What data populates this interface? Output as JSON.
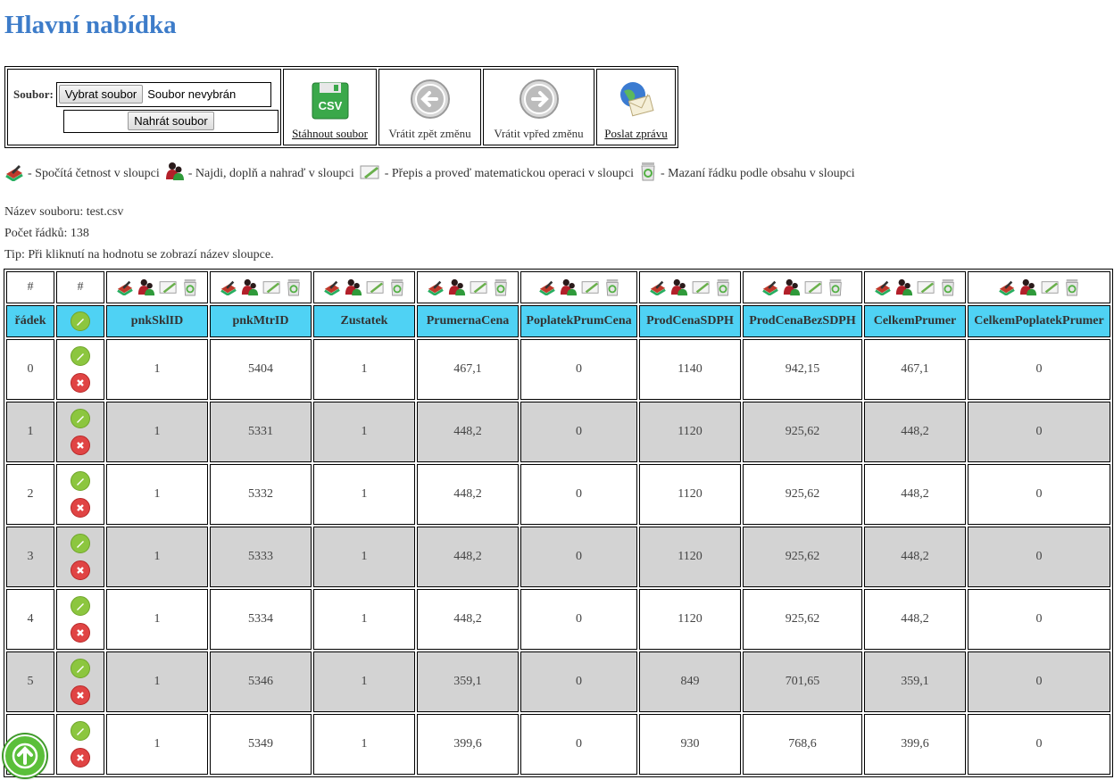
{
  "title": "Hlavní nabídka",
  "toolbar": {
    "file_label": "Soubor:",
    "choose_button": "Vybrat soubor",
    "file_status": "Soubor nevybrán",
    "upload_button": "Nahrát soubor",
    "csv_badge": "CSV",
    "download_label": "Stáhnout soubor",
    "undo_label": "Vrátit zpět změnu",
    "redo_label": "Vrátit vpřed změnu",
    "send_label": "Poslat zprávu"
  },
  "legend": {
    "count": "- Spočítá četnost v sloupci",
    "find": "- Najdi, doplň a nahraď v sloupci",
    "rewrite": "- Přepis a proveď matematickou operaci v sloupci",
    "delete": "- Mazaní řádku podle obsahu v sloupci"
  },
  "info": {
    "filename": "Název souboru: test.csv",
    "rows": "Počet řádků: 138",
    "tip": "Tip: Při kliknutí na hodnotu se zobrazí název sloupce."
  },
  "table": {
    "hash1": "#",
    "hash2": "#",
    "row_header": "řádek",
    "columns": [
      "pnkSklID",
      "pnkMtrID",
      "Zustatek",
      "PrumernaCena",
      "PoplatekPrumCena",
      "ProdCenaSDPH",
      "ProdCenaBezSDPH",
      "CelkemPrumer",
      "CelkemPoplatekPrumer"
    ],
    "rows": [
      {
        "idx": "0",
        "cells": [
          "1",
          "5404",
          "1",
          "467,1",
          "0",
          "1140",
          "942,15",
          "467,1",
          "0"
        ]
      },
      {
        "idx": "1",
        "cells": [
          "1",
          "5331",
          "1",
          "448,2",
          "0",
          "1120",
          "925,62",
          "448,2",
          "0"
        ]
      },
      {
        "idx": "2",
        "cells": [
          "1",
          "5332",
          "1",
          "448,2",
          "0",
          "1120",
          "925,62",
          "448,2",
          "0"
        ]
      },
      {
        "idx": "3",
        "cells": [
          "1",
          "5333",
          "1",
          "448,2",
          "0",
          "1120",
          "925,62",
          "448,2",
          "0"
        ]
      },
      {
        "idx": "4",
        "cells": [
          "1",
          "5334",
          "1",
          "448,2",
          "0",
          "1120",
          "925,62",
          "448,2",
          "0"
        ]
      },
      {
        "idx": "5",
        "cells": [
          "1",
          "5346",
          "1",
          "359,1",
          "0",
          "849",
          "701,65",
          "359,1",
          "0"
        ]
      },
      {
        "idx": "",
        "cells": [
          "1",
          "5349",
          "1",
          "399,6",
          "0",
          "930",
          "768,6",
          "399,6",
          "0"
        ]
      }
    ]
  }
}
